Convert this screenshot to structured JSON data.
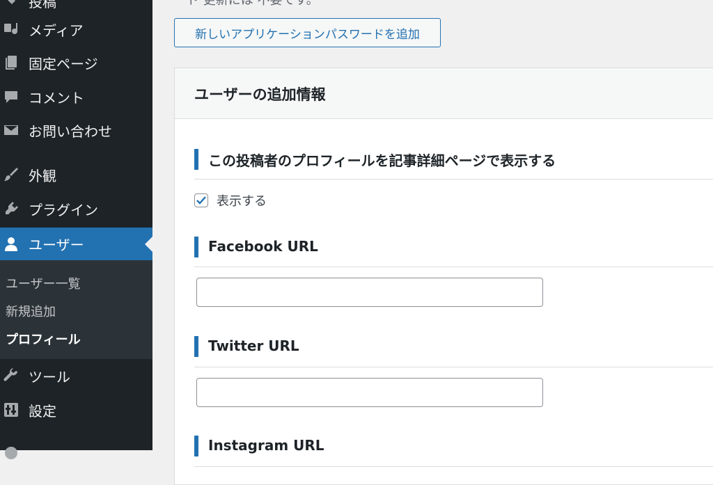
{
  "sidebar": {
    "menu": [
      {
        "label": "投稿",
        "icon": "pin-icon"
      },
      {
        "label": "メディア",
        "icon": "media-icon"
      },
      {
        "label": "固定ページ",
        "icon": "page-icon"
      },
      {
        "label": "コメント",
        "icon": "comment-icon"
      },
      {
        "label": "お問い合わせ",
        "icon": "mail-icon"
      },
      {
        "label": "外観",
        "icon": "brush-icon"
      },
      {
        "label": "プラグイン",
        "icon": "plugin-icon"
      },
      {
        "label": "ユーザー",
        "icon": "user-icon"
      },
      {
        "label": "ツール",
        "icon": "wrench-icon"
      },
      {
        "label": "設定",
        "icon": "settings-icon"
      }
    ],
    "submenu": [
      "ユーザー一覧",
      "新規追加",
      "プロフィール"
    ]
  },
  "main": {
    "top_text": "ード 更新には 不要です。",
    "add_app_password_label": "新しいアプリケーションパスワードを追加",
    "panel_title": "ユーザーの追加情報",
    "sections": [
      {
        "title": "この投稿者のプロフィールを記事詳細ページで表示する"
      },
      {
        "title": "Facebook URL",
        "value": ""
      },
      {
        "title": "Twitter URL",
        "value": ""
      },
      {
        "title": "Instagram URL"
      }
    ],
    "show_checkbox_label": "表示する",
    "show_checkbox_checked": true
  },
  "colors": {
    "accent": "#2271b1",
    "sidebar_bg": "#1d2327",
    "submenu_bg": "#2c3338"
  }
}
